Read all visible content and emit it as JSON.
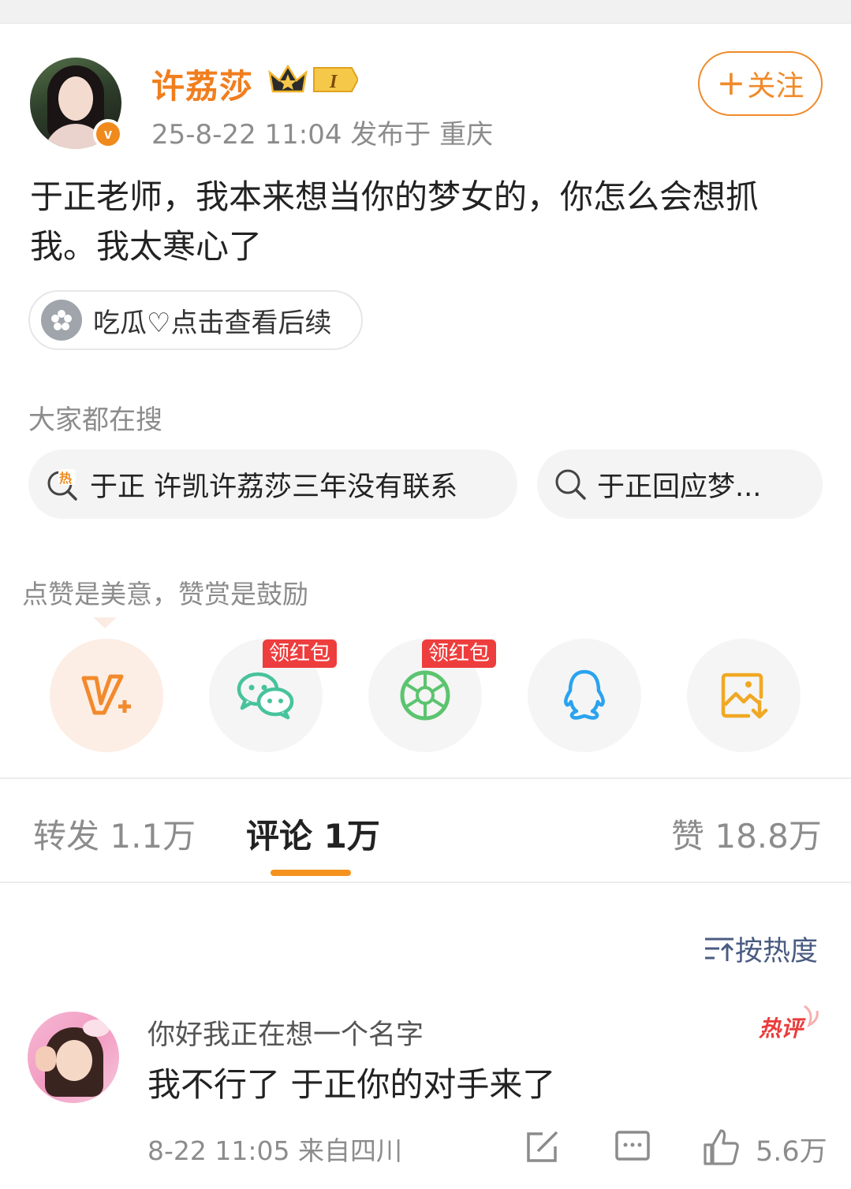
{
  "post": {
    "username": "许荔莎",
    "vip_level": "I",
    "verify_mark": "v",
    "meta": "25-8-22 11:04  发布于 重庆",
    "follow_plus": "+",
    "follow_label": "关注",
    "text": "于正老师，我本来想当你的梦女的，你怎么会想抓我。我太寒心了",
    "topic_chip": "吃瓜♡点击查看后续"
  },
  "search": {
    "title": "大家都在搜",
    "items": [
      {
        "label": "于正 许凯许荔莎三年没有联系",
        "icon": "hot-search-icon",
        "hot_mark": "热"
      },
      {
        "label": "于正回应梦...",
        "icon": "search-icon"
      }
    ]
  },
  "share": {
    "tip": "点赞是美意，赞赏是鼓励",
    "buttons": [
      {
        "icon": "reward-v-plus-icon",
        "color": "#f28a2d"
      },
      {
        "icon": "wechat-icon",
        "tag": "领红包",
        "color": "#47c39c"
      },
      {
        "icon": "moments-icon",
        "tag": "领红包",
        "color": "#5cc46f"
      },
      {
        "icon": "qq-icon",
        "color": "#2aa3ef"
      },
      {
        "icon": "save-image-icon",
        "color": "#f0a824"
      }
    ]
  },
  "tabs": [
    {
      "label": "转发 1.1万",
      "active": false
    },
    {
      "label": "评论 1万",
      "active": true
    },
    {
      "label": "赞 18.8万",
      "active": false
    }
  ],
  "sort": {
    "label": "按热度"
  },
  "comments": [
    {
      "user": "你好我正在想一个名字",
      "text": "我不行了 于正你的对手来了",
      "badge": "热评",
      "meta": "8-22 11:05  来自四川",
      "like_count": "5.6万"
    }
  ],
  "colors": {
    "accent": "#f17e1e",
    "underline": "#f5921e",
    "red_tag": "#ee3d3d",
    "sort_blue": "#4a5b82"
  }
}
